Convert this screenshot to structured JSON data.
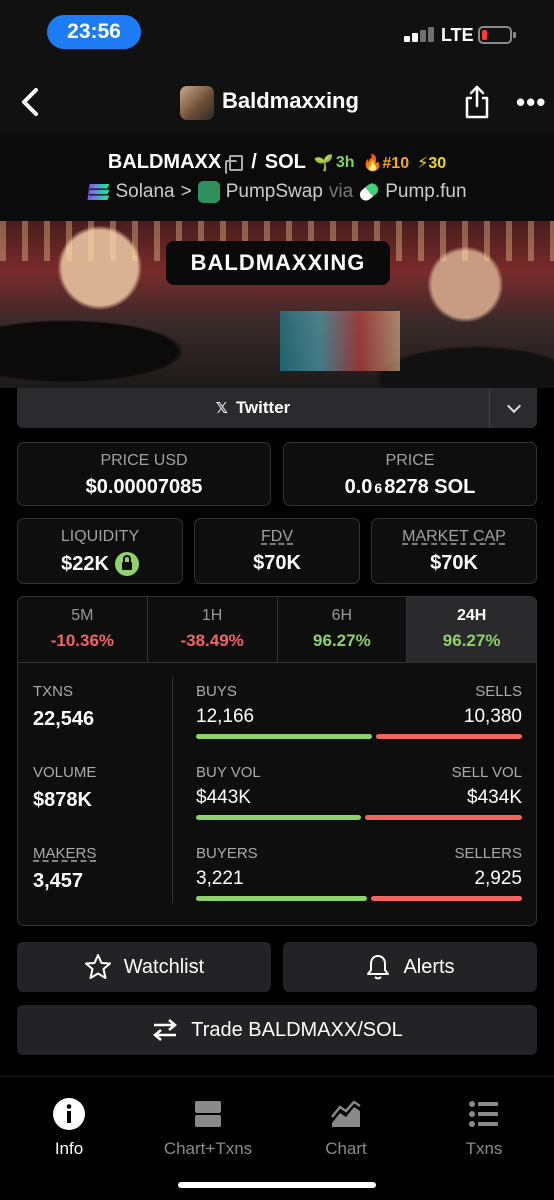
{
  "status": {
    "time": "23:56",
    "network": "LTE"
  },
  "nav": {
    "title": "Baldmaxxing"
  },
  "pair": {
    "base": "BALDMAXX",
    "separator": "/",
    "quote": "SOL",
    "age": "3h",
    "rank": "#10",
    "boosts": "30",
    "chain": "Solana",
    "dex": "PumpSwap",
    "via_label": "via",
    "launchpad": "Pump.fun"
  },
  "banner": {
    "text": "BALDMAXXING"
  },
  "socials": {
    "twitter_label": "Twitter"
  },
  "stats": {
    "price_usd_label": "PRICE USD",
    "price_usd": "$0.00007085",
    "price_label": "PRICE",
    "price_sol_prefix": "0.0",
    "price_sol_zeros": "6",
    "price_sol_suffix": "8278 SOL",
    "liquidity_label": "LIQUIDITY",
    "liquidity": "$22K",
    "fdv_label": "FDV",
    "fdv": "$70K",
    "mcap_label": "MARKET CAP",
    "mcap": "$70K"
  },
  "timeframes": [
    {
      "label": "5M",
      "change": "-10.36%",
      "dir": "neg"
    },
    {
      "label": "1H",
      "change": "-38.49%",
      "dir": "neg"
    },
    {
      "label": "6H",
      "change": "96.27%",
      "dir": "pos"
    },
    {
      "label": "24H",
      "change": "96.27%",
      "dir": "pos"
    }
  ],
  "activity": {
    "txns_label": "TXNS",
    "txns": "22,546",
    "volume_label": "VOLUME",
    "volume": "$878K",
    "makers_label": "MAKERS",
    "makers": "3,457",
    "buys_label": "BUYS",
    "buys": "12,166",
    "sells_label": "SELLS",
    "sells": "10,380",
    "buyvol_label": "BUY VOL",
    "buyvol": "$443K",
    "sellvol_label": "SELL VOL",
    "sellvol": "$434K",
    "buyers_label": "BUYERS",
    "buyers": "3,221",
    "sellers_label": "SELLERS",
    "sellers": "2,925",
    "buy_ratio_txns": 0.54,
    "buy_ratio_vol": 0.505,
    "buy_ratio_makers": 0.524
  },
  "actions": {
    "watchlist": "Watchlist",
    "alerts": "Alerts",
    "trade": "Trade BALDMAXX/SOL"
  },
  "tabbar": [
    {
      "label": "Info",
      "icon": "info-icon"
    },
    {
      "label": "Chart+Txns",
      "icon": "split-view-icon"
    },
    {
      "label": "Chart",
      "icon": "chart-icon"
    },
    {
      "label": "Txns",
      "icon": "list-icon"
    }
  ],
  "colors": {
    "accent": "#1e7cf6",
    "positive": "#8fd16a",
    "negative": "#f06464"
  }
}
